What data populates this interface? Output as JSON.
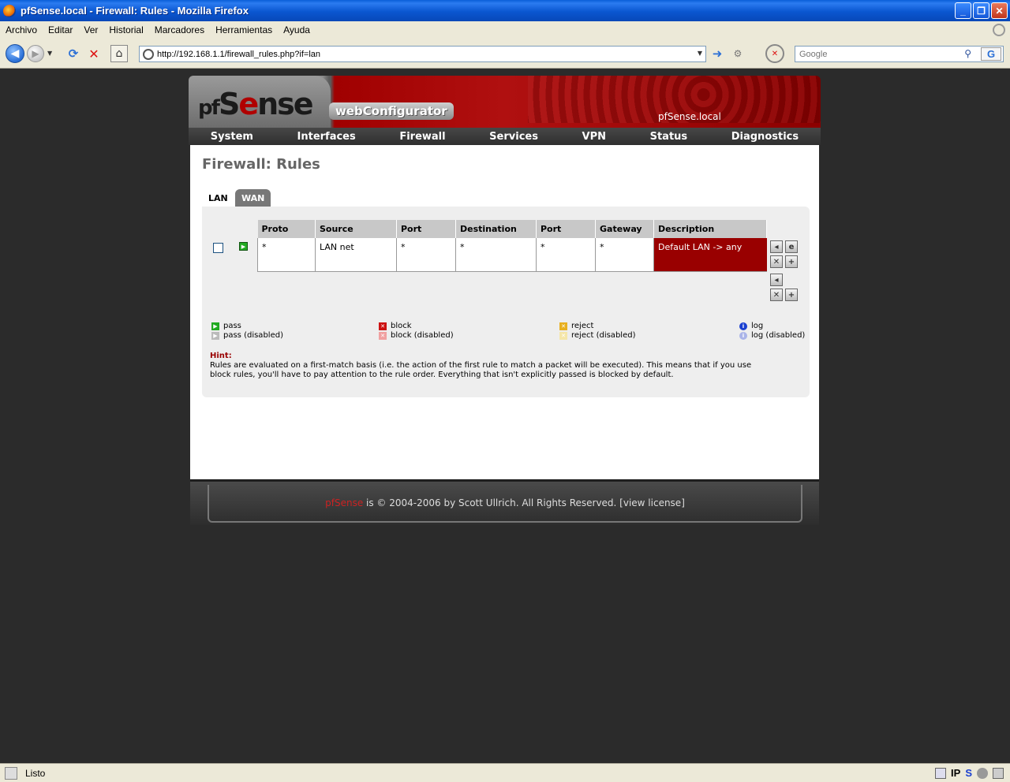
{
  "window": {
    "title": "pfSense.local - Firewall: Rules - Mozilla Firefox",
    "minimize": "_",
    "maximize": "❐",
    "close": "✕"
  },
  "menu": [
    "Archivo",
    "Editar",
    "Ver",
    "Historial",
    "Marcadores",
    "Herramientas",
    "Ayuda"
  ],
  "navbar": {
    "url": "http://192.168.1.1/firewall_rules.php?if=lan",
    "search_placeholder": "Google",
    "search_engine": "G"
  },
  "pfsense": {
    "logo_pf": "pf",
    "logo_s": "S",
    "logo_e": "e",
    "logo_nse": "nse",
    "webconfigurator": "webConfigurator",
    "hostname": "pfSense.local",
    "nav": [
      "System",
      "Interfaces",
      "Firewall",
      "Services",
      "VPN",
      "Status",
      "Diagnostics"
    ],
    "page_title": "Firewall: Rules",
    "tabs": [
      {
        "label": "LAN",
        "active": true
      },
      {
        "label": "WAN",
        "active": false
      }
    ],
    "table": {
      "headers": [
        "Proto",
        "Source",
        "Port",
        "Destination",
        "Port",
        "Gateway",
        "Description"
      ],
      "rows": [
        {
          "proto": "*",
          "source": "LAN net",
          "port": "*",
          "destination": "*",
          "dport": "*",
          "gateway": "*",
          "description": "Default LAN -> any",
          "action": "pass",
          "enabled": true
        }
      ]
    },
    "legend": [
      {
        "label": "pass",
        "icon": "pass-icon"
      },
      {
        "label": "pass (disabled)",
        "icon": "pass-disabled-icon"
      },
      {
        "label": "block",
        "icon": "block-icon"
      },
      {
        "label": "block (disabled)",
        "icon": "block-disabled-icon"
      },
      {
        "label": "reject",
        "icon": "reject-icon"
      },
      {
        "label": "reject (disabled)",
        "icon": "reject-disabled-icon"
      },
      {
        "label": "log",
        "icon": "log-icon"
      },
      {
        "label": "log (disabled)",
        "icon": "log-disabled-icon"
      }
    ],
    "hint_label": "Hint:",
    "hint_text": "Rules are evaluated on a first-match basis (i.e. the action of the first rule to match a packet will be executed). This means that if you use block rules, you'll have to pay attention to the rule order. Everything that isn't explicitly passed is blocked by default.",
    "footer": {
      "brand": "pfSense",
      "text": " is © 2004-2006 by Scott Ullrich. All Rights Reserved. [view license]"
    }
  },
  "status": {
    "text": "Listo",
    "ip_label": "IP",
    "s_label": "S"
  },
  "colors": {
    "accent_red": "#990000",
    "xp_blue": "#0a56d0"
  }
}
